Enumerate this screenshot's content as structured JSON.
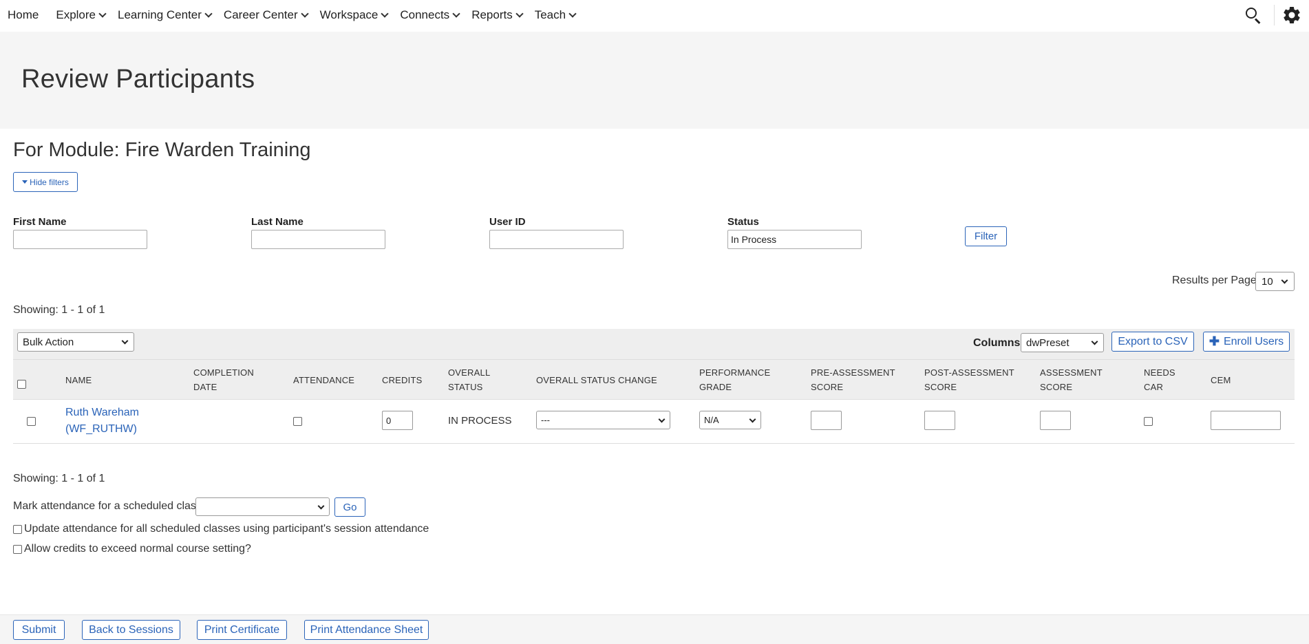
{
  "nav": {
    "items": [
      {
        "label": "Home",
        "has_dropdown": false
      },
      {
        "label": "Explore",
        "has_dropdown": true
      },
      {
        "label": "Learning Center",
        "has_dropdown": true
      },
      {
        "label": "Career Center",
        "has_dropdown": true
      },
      {
        "label": "Workspace",
        "has_dropdown": true
      },
      {
        "label": "Connects",
        "has_dropdown": true
      },
      {
        "label": "Reports",
        "has_dropdown": true
      },
      {
        "label": "Teach",
        "has_dropdown": true
      }
    ],
    "icons": [
      "search-icon",
      "gear-icon"
    ]
  },
  "page": {
    "title": "Review Participants",
    "module_title": "For Module: Fire Warden Training",
    "hide_filters_label": "Hide filters"
  },
  "filters": {
    "first_name": {
      "label": "First Name",
      "value": ""
    },
    "last_name": {
      "label": "Last Name",
      "value": ""
    },
    "user_id": {
      "label": "User ID",
      "value": ""
    },
    "status": {
      "label": "Status",
      "value": "In Process"
    },
    "filter_button": "Filter"
  },
  "pagination": {
    "results_per_page_label": "Results per Page:",
    "results_per_page_value": "10",
    "showing_top": "Showing: 1 - 1 of 1",
    "showing_bottom": "Showing: 1 - 1 of 1"
  },
  "toolbar": {
    "bulk_action": "Bulk Action",
    "columns_label": "Columns",
    "columns_value": "dwPreset",
    "export_label": "Export to CSV",
    "enroll_label": "Enroll Users"
  },
  "table": {
    "headers": {
      "name": "NAME",
      "completion_date_1": "COMPLETION",
      "completion_date_2": "DATE",
      "attendance": "ATTENDANCE",
      "credits": "CREDITS",
      "overall_status_1": "OVERALL",
      "overall_status_2": "STATUS",
      "overall_status_change": "OVERALL STATUS CHANGE",
      "performance_grade_1": "PERFORMANCE",
      "performance_grade_2": "GRADE",
      "pre_assessment_1": "PRE-ASSESSMENT",
      "pre_assessment_2": "SCORE",
      "post_assessment_1": "POST-ASSESSMENT",
      "post_assessment_2": "SCORE",
      "assessment_1": "ASSESSMENT",
      "assessment_2": "SCORE",
      "needs_car_1": "NEEDS",
      "needs_car_2": "CAR",
      "cem": "CEM"
    },
    "rows": [
      {
        "name_line1": "Ruth Wareham",
        "name_line2": "(WF_RUTHW)",
        "completion_date": "",
        "attendance_checked": false,
        "credits": "0",
        "overall_status": "IN PROCESS",
        "status_change": "---",
        "performance_grade": "N/A",
        "pre_assessment": "",
        "post_assessment": "",
        "assessment": "",
        "needs_car": false,
        "cem": ""
      }
    ]
  },
  "attendance": {
    "mark_label": "Mark attendance for a scheduled class:",
    "class_value": "",
    "go_label": "Go",
    "update_all_label": "Update attendance for all scheduled classes using participant's session attendance",
    "allow_credits_label": "Allow credits to exceed normal course setting?"
  },
  "footer": {
    "submit": "Submit",
    "back": "Back to Sessions",
    "print_certificate": "Print Certificate",
    "print_attendance": "Print Attendance Sheet"
  },
  "colors": {
    "accent": "#2a63b8",
    "banner_bg": "#f5f5f5",
    "table_header_bg": "#eeeeee"
  }
}
